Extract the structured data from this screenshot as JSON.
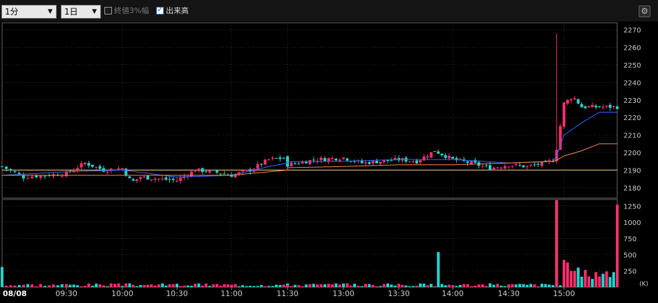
{
  "toolbar": {
    "interval": "1分",
    "period": "1日",
    "range3_label": "終値3%幅",
    "range3_checked": false,
    "volume_label": "出来高",
    "volume_checked": true
  },
  "icons": {
    "settings": "gear-icon",
    "dropdown": "chevron-down-icon"
  },
  "colors": {
    "background": "#000000",
    "up": "#ff2e6a",
    "down": "#1fd6d0",
    "ma_short": "#2f6bff",
    "ma_long": "#ff8a4c",
    "prev_close": "#ffd28a",
    "grid": "#555555"
  },
  "chart_data": [
    {
      "type": "candlestick",
      "date_label": "08/08",
      "x_tick_labels": [
        "09:30",
        "10:00",
        "10:30",
        "11:00",
        "11:30",
        "13:00",
        "13:30",
        "14:00",
        "14:30",
        "15:00"
      ],
      "y_ticks": [
        2180,
        2190,
        2200,
        2210,
        2220,
        2230,
        2240,
        2250,
        2260,
        2270
      ],
      "ylim": [
        2174,
        2274
      ],
      "grid": true,
      "reference_line": 2190,
      "series": [
        {
          "kind": "price_close",
          "x": [
            "09:00",
            "09:10",
            "09:20",
            "09:30",
            "09:40",
            "09:50",
            "10:00",
            "10:05",
            "10:10",
            "10:20",
            "10:30",
            "10:40",
            "10:50",
            "11:00",
            "11:10",
            "11:20",
            "11:30",
            "12:30",
            "12:45",
            "13:00",
            "13:10",
            "13:20",
            "13:30",
            "13:40",
            "13:50",
            "14:00",
            "14:10",
            "14:20",
            "14:30",
            "14:40",
            "14:50",
            "14:55",
            "15:00",
            "15:05",
            "15:10",
            "15:20"
          ],
          "y": [
            2192,
            2186,
            2187,
            2188,
            2194,
            2190,
            2191,
            2183,
            2186,
            2185,
            2184,
            2190,
            2189,
            2187,
            2190,
            2196,
            2197,
            2193,
            2196,
            2197,
            2194,
            2195,
            2196,
            2195,
            2201,
            2196,
            2194,
            2191,
            2193,
            2192,
            2194,
            2196,
            2228,
            2232,
            2226,
            2226
          ]
        },
        {
          "kind": "ma",
          "name": "",
          "color": "#2f6bff",
          "x": [
            "09:00",
            "09:30",
            "10:00",
            "10:30",
            "11:00",
            "11:20",
            "11:30",
            "13:00",
            "13:30",
            "14:00",
            "14:30",
            "14:55",
            "15:00",
            "15:10",
            "15:20"
          ],
          "y": [
            2187,
            2189,
            2190,
            2186,
            2187,
            2192,
            2194,
            2195,
            2196,
            2196,
            2194,
            2195,
            2210,
            2217,
            2223
          ]
        },
        {
          "kind": "ma",
          "name": "",
          "color": "#ff8a4c",
          "x": [
            "09:00",
            "10:00",
            "11:00",
            "11:30",
            "13:00",
            "13:30",
            "14:00",
            "14:30",
            "14:55",
            "15:00",
            "15:10",
            "15:20"
          ],
          "y": [
            2187,
            2187,
            2187,
            2190,
            2192,
            2193,
            2193,
            2194,
            2195,
            2198,
            2201,
            2205
          ]
        },
        {
          "kind": "spike",
          "x": "14:56",
          "high": 2268,
          "low": 2194
        }
      ]
    },
    {
      "type": "bar",
      "name": "volume",
      "unit_label": "(K)",
      "y_ticks": [
        250,
        500,
        750,
        1000,
        1250
      ],
      "ylim": [
        0,
        1350
      ],
      "typical_volume": 40,
      "spikes": [
        {
          "x": "09:00",
          "value": 310
        },
        {
          "x": "13:52",
          "value": 540
        },
        {
          "x": "14:56",
          "value": 1340
        },
        {
          "x": "15:00",
          "value": 420
        },
        {
          "x": "15:02",
          "value": 380
        },
        {
          "x": "15:05",
          "value": 250
        },
        {
          "x": "15:10",
          "value": 160
        },
        {
          "x": "15:30",
          "value": 1270
        }
      ]
    }
  ]
}
